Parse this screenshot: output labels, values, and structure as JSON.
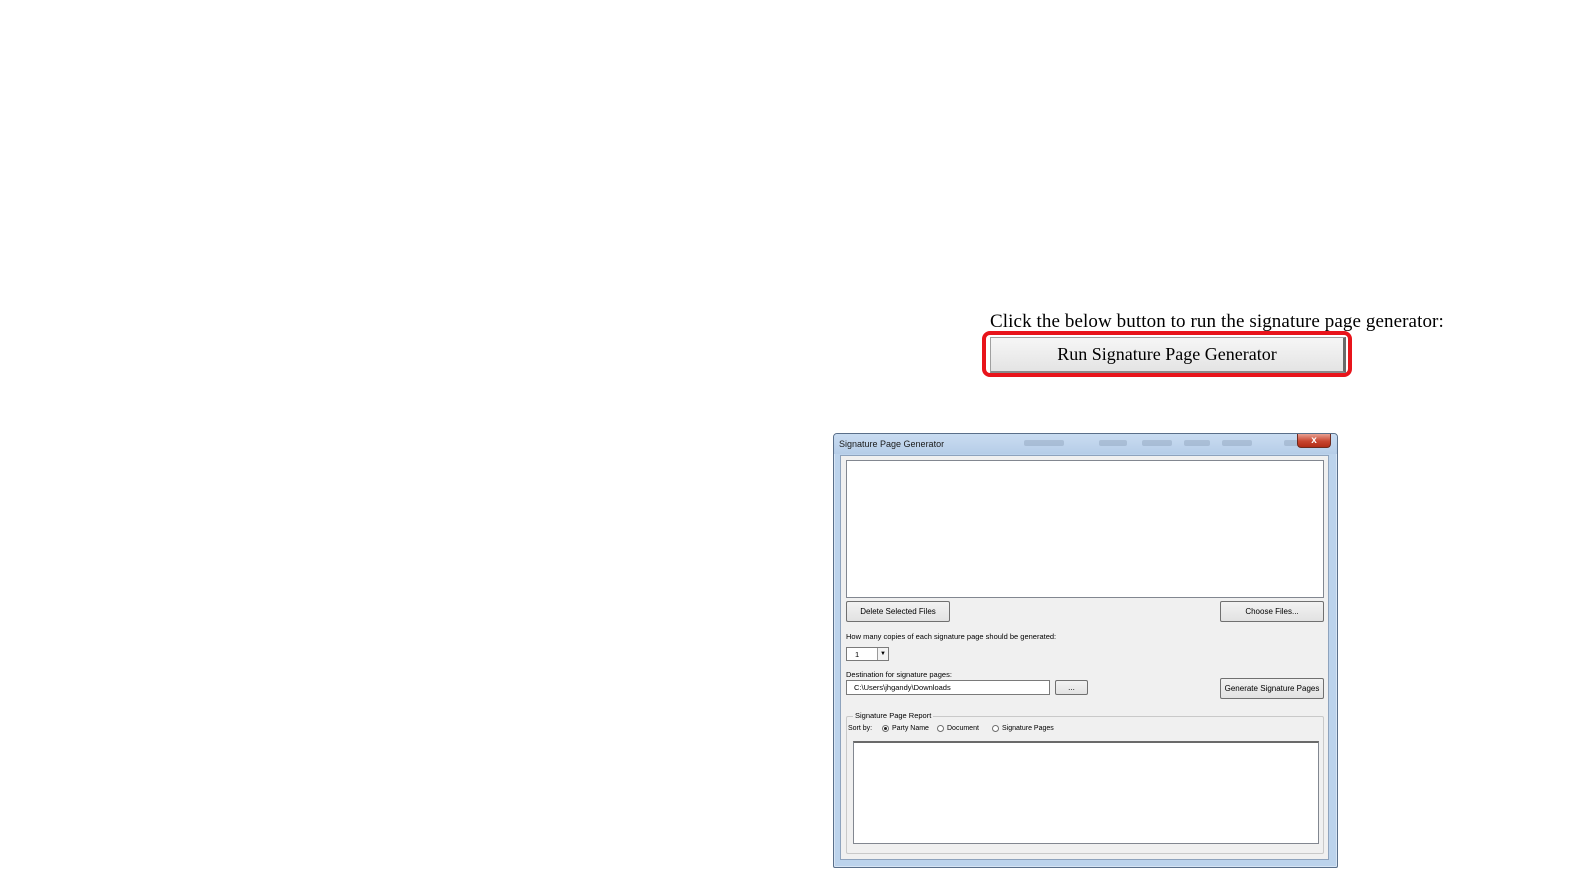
{
  "instruction": {
    "text": "Click the below button to run the signature page generator:"
  },
  "run_button": {
    "label": "Run Signature Page Generator",
    "highlight_color": "#e8141b"
  },
  "dialog": {
    "title": "Signature Page Generator",
    "close_label": "x",
    "delete_files_label": "Delete Selected Files",
    "choose_files_label": "Choose Files...",
    "copies_question": "How many copies of each signature page should be generated:",
    "copies_value": "1",
    "destination_label": "Destination for signature pages:",
    "destination_value": "C:\\Users\\jhgandy\\Downloads",
    "browse_label": "...",
    "generate_label": "Generate Signature Pages",
    "report": {
      "title": "Signature Page Report",
      "sort_by_label": "Sort by:",
      "options": [
        {
          "label": "Party Name",
          "checked": true
        },
        {
          "label": "Document",
          "checked": false
        },
        {
          "label": "Signature Pages",
          "checked": false
        }
      ]
    }
  }
}
